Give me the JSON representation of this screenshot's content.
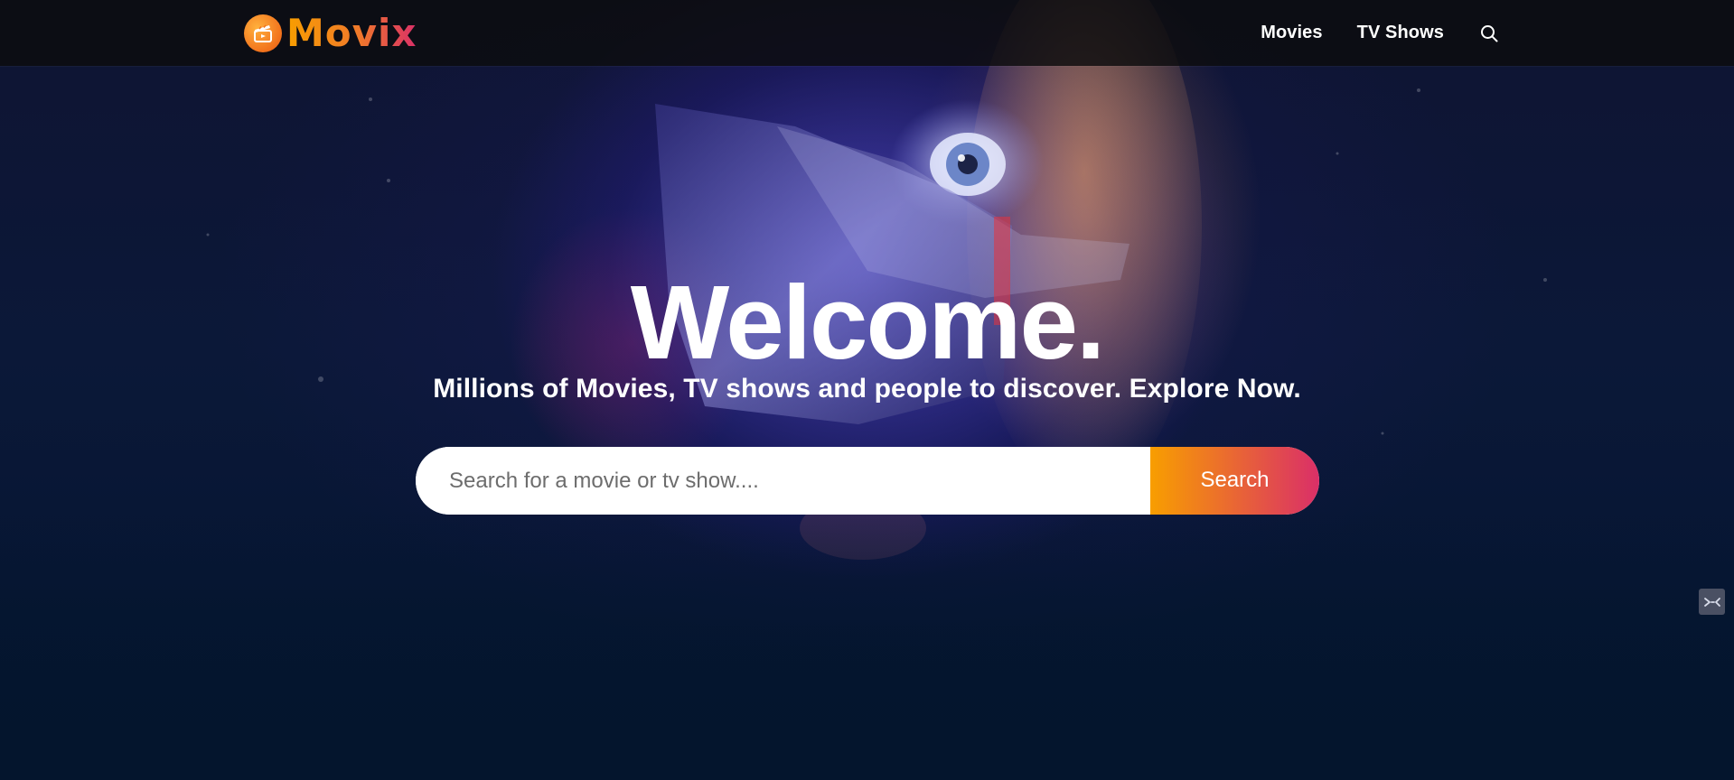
{
  "header": {
    "logo_text": "Movix",
    "logo_icon": "clapperboard-icon",
    "nav": [
      {
        "label": "Movies"
      },
      {
        "label": "TV Shows"
      }
    ],
    "search_icon": "search-icon"
  },
  "hero": {
    "title": "Welcome.",
    "subtitle": "Millions of Movies, TV shows and people to discover. Explore Now.",
    "search": {
      "placeholder": "Search for a movie or tv show....",
      "value": "",
      "button_label": "Search"
    }
  },
  "floating_widget": {
    "icon": "devtools-icon"
  },
  "colors": {
    "brand_orange": "#f89e00",
    "brand_pink": "#da2f68",
    "background": "#04152d",
    "header_bg": "#0c0c0e"
  }
}
